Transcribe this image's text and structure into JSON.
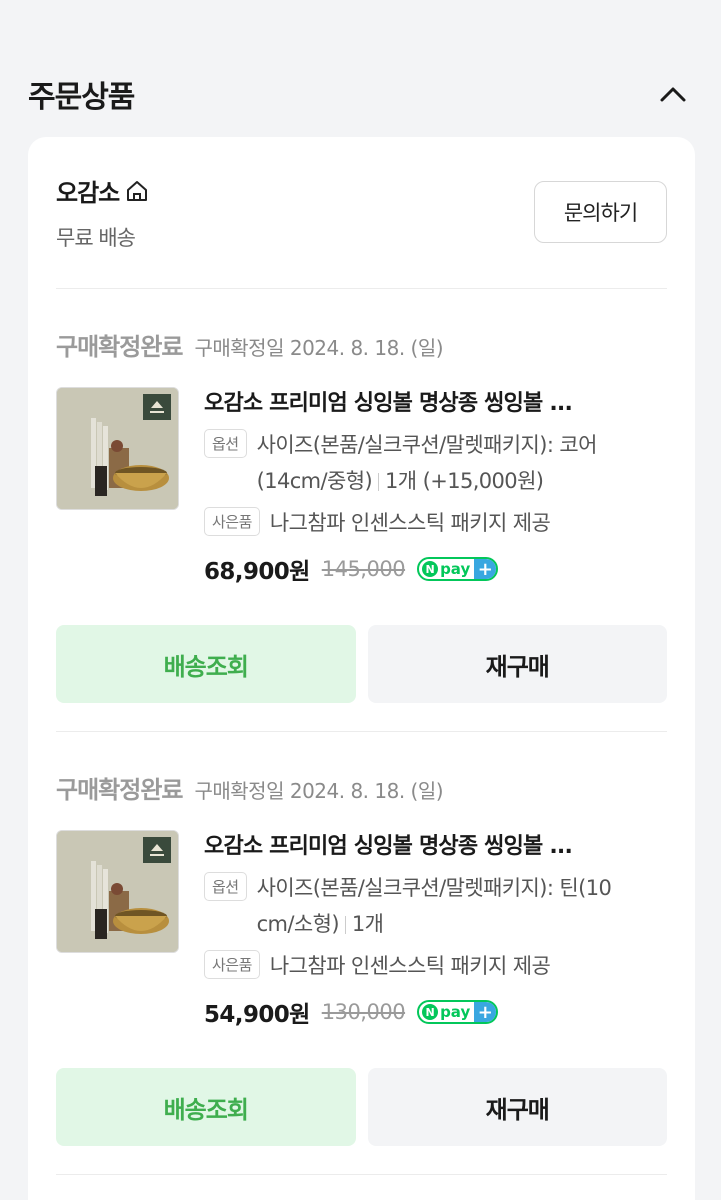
{
  "section": {
    "title": "주문상품"
  },
  "store": {
    "name": "오감소",
    "shipping": "무료 배송",
    "inquiry_label": "문의하기"
  },
  "orders": [
    {
      "status": "구매확정완료",
      "status_date": "구매확정일 2024. 8. 18. (일)",
      "product_title": "오감소 프리미엄 싱잉볼 명상종 씽잉볼 ...",
      "thumb_logo": "오감소",
      "option_tag": "옵션",
      "option_line1": "사이즈(본품/실크쿠션/말렛패키지): 코어",
      "option_line2_a": "(14cm/중형)",
      "option_line2_b": "1개 (+15,000원)",
      "gift_tag": "사은품",
      "gift_text": "나그참파 인센스스틱 패키지 제공",
      "price": "68,900원",
      "original_price": "145,000",
      "npay_label": "pay",
      "track_label": "배송조회",
      "rebuy_label": "재구매"
    },
    {
      "status": "구매확정완료",
      "status_date": "구매확정일 2024. 8. 18. (일)",
      "product_title": "오감소 프리미엄 싱잉볼 명상종 씽잉볼 ...",
      "thumb_logo": "오감소",
      "option_tag": "옵션",
      "option_line1": "사이즈(본품/실크쿠션/말렛패키지): 틴(10",
      "option_line2_a": "cm/소형)",
      "option_line2_b": "1개",
      "gift_tag": "사은품",
      "gift_text": "나그참파 인센스스틱 패키지 제공",
      "price": "54,900원",
      "original_price": "130,000",
      "npay_label": "pay",
      "track_label": "배송조회",
      "rebuy_label": "재구매"
    }
  ],
  "icons": {
    "collapse": "chevron-up-icon",
    "store_home": "home-icon",
    "npay": "npay-plus-icon"
  },
  "colors": {
    "accent_green": "#3fae4e",
    "track_bg": "#e1f7e6",
    "npay_green": "#03c75a"
  }
}
